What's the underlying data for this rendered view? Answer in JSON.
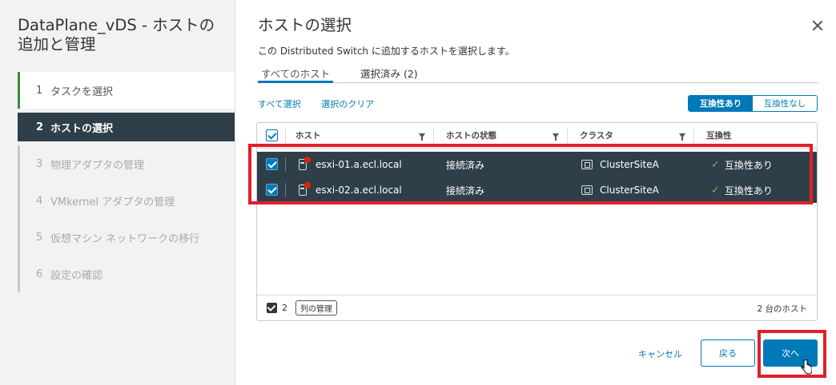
{
  "sidebar": {
    "title": "DataPlane_vDS - ホストの追加と管理",
    "steps": [
      {
        "num": "1",
        "label": "タスクを選択"
      },
      {
        "num": "2",
        "label": "ホストの選択"
      },
      {
        "num": "3",
        "label": "物理アダプタの管理"
      },
      {
        "num": "4",
        "label": "VMkernel アダプタの管理"
      },
      {
        "num": "5",
        "label": "仮想マシン ネットワークの移行"
      },
      {
        "num": "6",
        "label": "設定の確認"
      }
    ]
  },
  "page": {
    "title": "ホストの選択",
    "description": "この Distributed Switch に追加するホストを選択します。"
  },
  "tabs": [
    {
      "label": "すべてのホスト"
    },
    {
      "label": "選択済み (2)"
    }
  ],
  "actions": {
    "select_all": "すべて選択",
    "clear_selection": "選択のクリア"
  },
  "toggle": {
    "compatible": "互換性あり",
    "incompatible": "互換性なし"
  },
  "grid": {
    "columns": [
      "ホスト",
      "ホストの状態",
      "クラスタ",
      "互換性"
    ],
    "rows": [
      {
        "host": "esxi-01.a.ecl.local",
        "state": "接続済み",
        "cluster": "ClusterSiteA",
        "compat": "互換性あり"
      },
      {
        "host": "esxi-02.a.ecl.local",
        "state": "接続済み",
        "cluster": "ClusterSiteA",
        "compat": "互換性あり"
      }
    ],
    "footer": {
      "selected_count": "2",
      "column_manager": "列の管理",
      "total": "2 台のホスト"
    }
  },
  "buttons": {
    "cancel": "キャンセル",
    "back": "戻る",
    "next": "次へ"
  },
  "colors": {
    "accent": "#0079b8",
    "selected_row": "#2e3f4a",
    "highlight": "#e0202a",
    "complete_step": "#3c8a3a",
    "compat_check": "#6cb851"
  }
}
